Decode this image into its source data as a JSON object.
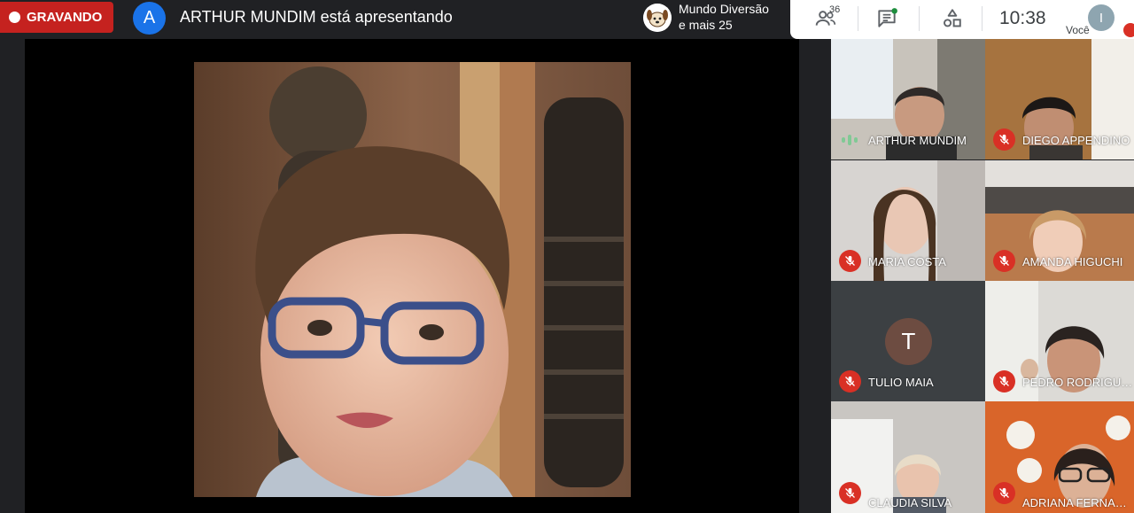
{
  "recording": {
    "label": "GRAVANDO"
  },
  "presenter": {
    "initial": "A",
    "text": "ARTHUR MUNDIM está apresentando"
  },
  "chat_preview": {
    "line1": "Mundo Diversão",
    "line2": "e mais 25"
  },
  "controls": {
    "participant_count": "36",
    "time": "10:38",
    "self_initial": "I",
    "self_label": "Você"
  },
  "tiles": [
    {
      "name": "ARTHUR MUNDIM",
      "status": "speaking"
    },
    {
      "name": "DIEGO APPENDINO",
      "status": "muted"
    },
    {
      "name": "MARIA COSTA",
      "status": "muted"
    },
    {
      "name": "AMANDA HIGUCHI",
      "status": "muted"
    },
    {
      "name": "TULIO MAIA",
      "status": "muted",
      "initial": "T"
    },
    {
      "name": "PEDRO RODRIGU…",
      "status": "muted"
    },
    {
      "name": "CLAUDIA SILVA",
      "status": "muted"
    },
    {
      "name": "ADRIANA FERNA…",
      "status": "muted"
    }
  ],
  "colors": {
    "record_red": "#c5221f",
    "mute_red": "#d93025",
    "accent_blue": "#1a73e8",
    "speaking_green": "#81c995"
  }
}
